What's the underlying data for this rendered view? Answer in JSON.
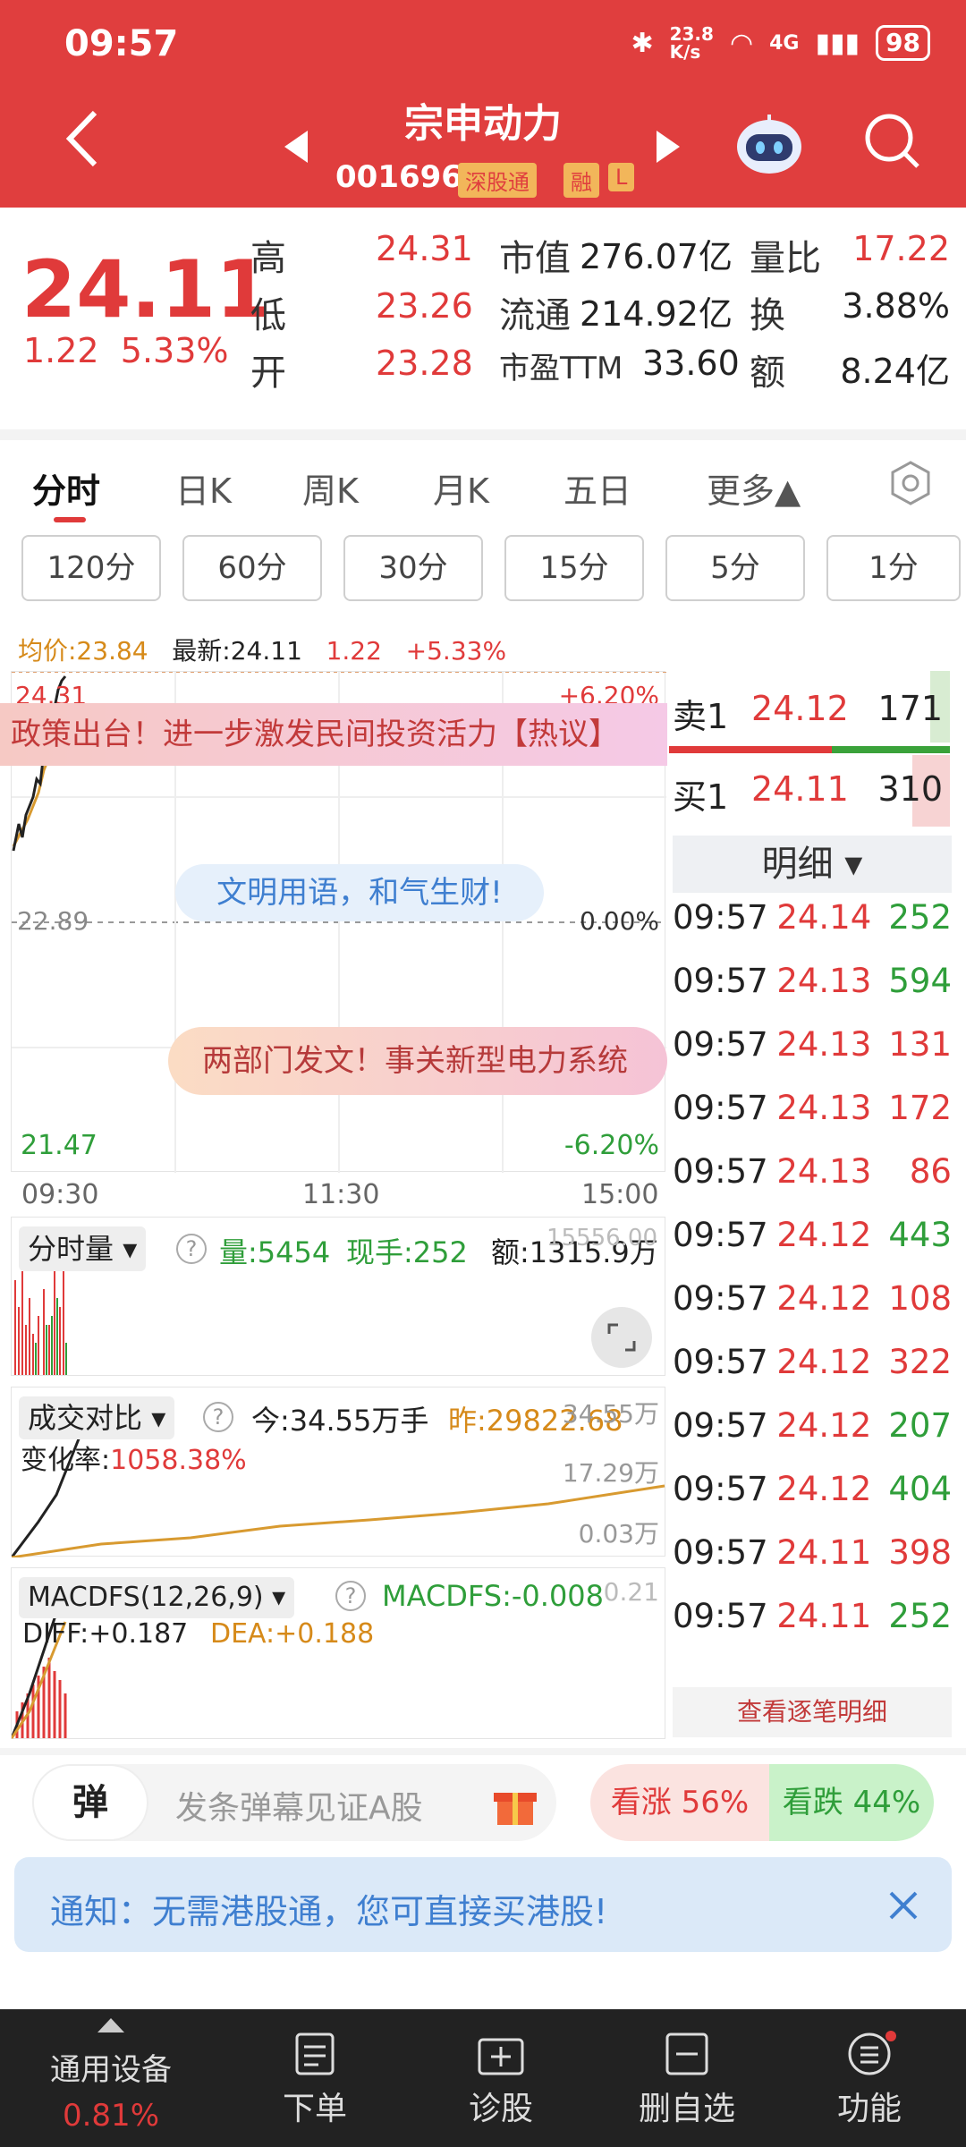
{
  "status_bar": {
    "time": "09:57",
    "net_speed": "23.8\nK/s",
    "net_type": "4G",
    "battery": "98"
  },
  "header": {
    "title": "宗申动力",
    "code": "001696",
    "tag_hk": "深股通",
    "tag_margin": "融",
    "tag_l": "L"
  },
  "quote": {
    "price": "24.11",
    "change": "1.22",
    "change_pct": "5.33%",
    "high_label": "高",
    "high": "24.31",
    "low_label": "低",
    "low": "23.26",
    "open_label": "开",
    "open": "23.28",
    "mcap_label": "市值",
    "mcap": "276.07亿",
    "float_label": "流通",
    "float": "214.92亿",
    "pe_label": "市盈TTM",
    "pe": "33.60",
    "volratio_label": "量比",
    "volratio": "17.22",
    "turnover_label": "换",
    "turnover": "3.88%",
    "amount_label": "额",
    "amount": "8.24亿"
  },
  "tabs": [
    "分时",
    "日K",
    "周K",
    "月K",
    "五日",
    "更多▲"
  ],
  "periods": [
    "120分",
    "60分",
    "30分",
    "15分",
    "5分",
    "1分"
  ],
  "chart": {
    "avg_label": "均价:23.84",
    "latest_label": "最新:24.11",
    "chg": "1.22",
    "chg_pct": "+5.33%",
    "top_price": "24.31",
    "top_pct": "+6.20%",
    "mid_price": "22.89",
    "mid_pct": "0.00%",
    "bot_price": "21.47",
    "bot_pct": "-6.20%",
    "time_start": "09:30",
    "time_mid": "11:30",
    "time_end": "15:00",
    "banner1": "政策出台！进一步激发民间投资活力【热议】",
    "banner2": "文明用语，和气生财!",
    "banner3": "两部门发文！事关新型电力系统",
    "vol_title": "分时量",
    "vol": "量:5454",
    "cur_hand": "现手:252",
    "amt": "额:1315.9万",
    "vol_right": "15556.00",
    "cmp_title": "成交对比",
    "today": "今:34.55万手",
    "yest": "昨:29822.68",
    "change_rate_label": "变化率:",
    "change_rate": "1058.38%",
    "cmp_y1": "34.55万",
    "cmp_y2": "17.29万",
    "cmp_y3": "0.03万",
    "macd_title": "MACDFS(12,26,9)",
    "macd_val": "MACDFS:-0.008",
    "macd_right": "0.21",
    "diff": "DIFF:+0.187",
    "dea": "DEA:+0.188"
  },
  "orderbook": {
    "sell1_label": "卖1",
    "sell1_price": "24.12",
    "sell1_vol": "171",
    "buy1_label": "买1",
    "buy1_price": "24.11",
    "buy1_vol": "310",
    "detail_label": "明细 ▾",
    "trades": [
      {
        "time": "09:57",
        "price": "24.14",
        "vol": "252",
        "dir": "green"
      },
      {
        "time": "09:57",
        "price": "24.13",
        "vol": "594",
        "dir": "green"
      },
      {
        "time": "09:57",
        "price": "24.13",
        "vol": "131",
        "dir": "red"
      },
      {
        "time": "09:57",
        "price": "24.13",
        "vol": "172",
        "dir": "red"
      },
      {
        "time": "09:57",
        "price": "24.13",
        "vol": "86",
        "dir": "red"
      },
      {
        "time": "09:57",
        "price": "24.12",
        "vol": "443",
        "dir": "green"
      },
      {
        "time": "09:57",
        "price": "24.12",
        "vol": "108",
        "dir": "red"
      },
      {
        "time": "09:57",
        "price": "24.12",
        "vol": "322",
        "dir": "red"
      },
      {
        "time": "09:57",
        "price": "24.12",
        "vol": "207",
        "dir": "green"
      },
      {
        "time": "09:57",
        "price": "24.12",
        "vol": "404",
        "dir": "green"
      },
      {
        "time": "09:57",
        "price": "24.11",
        "vol": "398",
        "dir": "red"
      },
      {
        "time": "09:57",
        "price": "24.11",
        "vol": "252",
        "dir": "green"
      }
    ],
    "view_all": "查看逐笔明细"
  },
  "danmaku": {
    "icon_text": "弹",
    "placeholder": "发条弹幕见证A股",
    "up": "看涨 56%",
    "down": "看跌 44%"
  },
  "notice": {
    "text": "通知：无需港股通，您可直接买港股!"
  },
  "bottom": {
    "sector": "通用设备",
    "sector_pct": "0.81%",
    "order": "下单",
    "diagnose": "诊股",
    "remove_fav": "删自选",
    "functions": "功能"
  }
}
